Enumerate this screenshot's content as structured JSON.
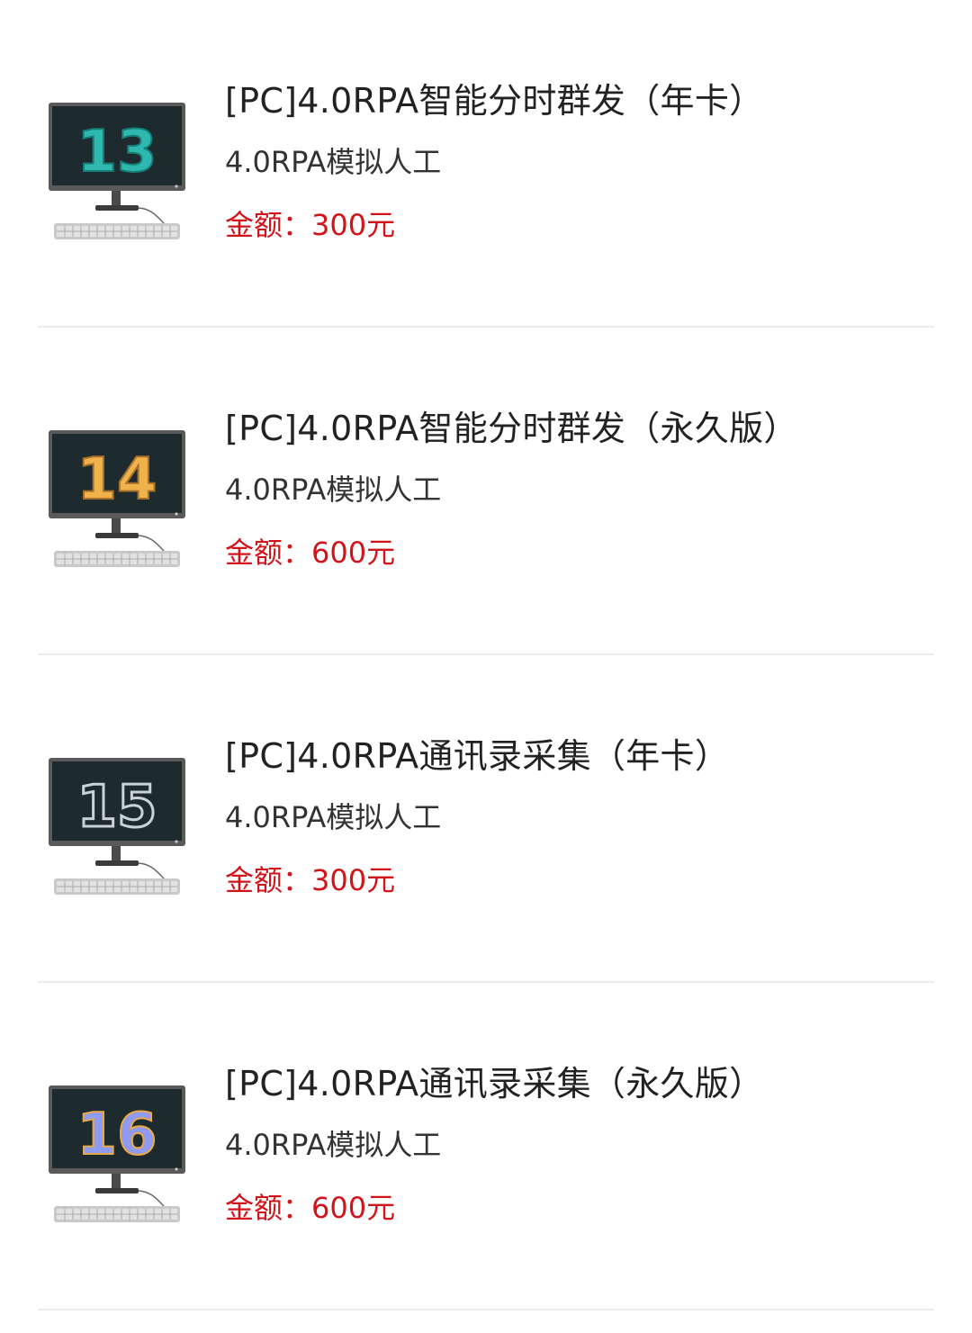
{
  "products": [
    {
      "badge_number": "13",
      "title": "[PC]4.0RPA智能分时群发（年卡）",
      "subtitle": "4.0RPA模拟人工",
      "price_text": "金额：300元",
      "badge_color": "#2fb8b0"
    },
    {
      "badge_number": "14",
      "title": "[PC]4.0RPA智能分时群发（永久版）",
      "subtitle": "4.0RPA模拟人工",
      "price_text": "金额：600元",
      "badge_color": "#f0b24a"
    },
    {
      "badge_number": "15",
      "title": "[PC]4.0RPA通讯录采集（年卡）",
      "subtitle": "4.0RPA模拟人工",
      "price_text": "金额：300元",
      "badge_color": "#c9d3d6"
    },
    {
      "badge_number": "16",
      "title": "[PC]4.0RPA通讯录采集（永久版）",
      "subtitle": "4.0RPA模拟人工",
      "price_text": "金额：600元",
      "badge_color": "#8f9bf0"
    }
  ],
  "colors": {
    "price": "#d2141a",
    "title": "#222222",
    "divider": "#ececec",
    "monitor_screen": "#1d2a2e"
  },
  "icons": [
    "computer-monitor-icon",
    "keyboard-icon"
  ]
}
